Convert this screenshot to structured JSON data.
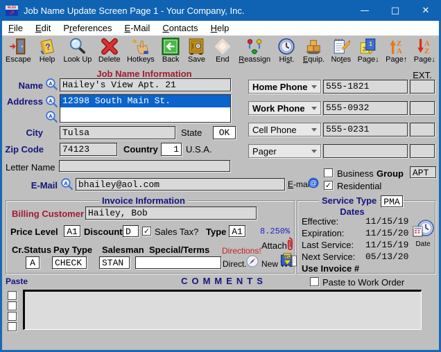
{
  "window": {
    "title": "Job Name Update Screen Page 1 - Your Company, Inc.",
    "icon_text": "BLSS",
    "controls": {
      "minimize": "—",
      "maximize": "□",
      "close": "✕"
    }
  },
  "menu": [
    {
      "pre": "",
      "key": "F",
      "post": "ile"
    },
    {
      "pre": "",
      "key": "E",
      "post": "dit"
    },
    {
      "pre": "P",
      "key": "r",
      "post": "eferences"
    },
    {
      "pre": "",
      "key": "E",
      "post": "-Mail"
    },
    {
      "pre": "",
      "key": "C",
      "post": "ontacts"
    },
    {
      "pre": "",
      "key": "H",
      "post": "elp"
    }
  ],
  "toolbar": [
    {
      "pre": "Escape",
      "key": "",
      "post": ""
    },
    {
      "pre": "Help",
      "key": "",
      "post": ""
    },
    {
      "pre": "Look Up",
      "key": "",
      "post": ""
    },
    {
      "pre": "Delete",
      "key": "",
      "post": ""
    },
    {
      "pre": "Hotkeys",
      "key": "",
      "post": ""
    },
    {
      "pre": "Back",
      "key": "",
      "post": ""
    },
    {
      "pre": "Save",
      "key": "",
      "post": ""
    },
    {
      "pre": "End",
      "key": "",
      "post": ""
    },
    {
      "pre": "",
      "key": "R",
      "post": "eassign"
    },
    {
      "pre": "Hi",
      "key": "s",
      "post": "t."
    },
    {
      "pre": "",
      "key": "E",
      "post": "quip."
    },
    {
      "pre": "No",
      "key": "t",
      "post": "es"
    },
    {
      "pre": "Page↓",
      "key": "",
      "post": ""
    },
    {
      "pre": "Page↑",
      "key": "",
      "post": ""
    },
    {
      "pre": "Page↓",
      "key": "",
      "post": ""
    }
  ],
  "job": {
    "section_title": "Job Name Information",
    "name_label": "Name",
    "name_value": "Hailey's View Apt. 21",
    "address_label": "Address",
    "address_line1": "12398 South Main St.",
    "city_label": "City",
    "city_value": "Tulsa",
    "state_label": "State",
    "state_value": "OK",
    "zip_label": "Zip Code",
    "zip_value": "74123",
    "country_label": "Country",
    "country_value": "1",
    "country_name": "U.S.A.",
    "letter_label": "Letter Name",
    "letter_value": "",
    "email_label": "E-Mail",
    "email_value": "bhailey@aol.com",
    "emails": {
      "pre": "",
      "key": "E",
      "post": "-mails"
    },
    "ext_label": "EXT.",
    "phones": [
      {
        "type": "Home Phone",
        "number": "555-1821",
        "ext": ""
      },
      {
        "type": "Work Phone",
        "number": "555-0932",
        "ext": ""
      },
      {
        "type": "Cell Phone",
        "number": "555-0231",
        "ext": ""
      },
      {
        "type": "Pager",
        "number": "",
        "ext": ""
      }
    ],
    "business_label": "Business",
    "group_label": "Group",
    "group_value": "APT",
    "residential_label": "Residential"
  },
  "checks": {
    "business": "",
    "residential": "✓",
    "sales_tax": "✓",
    "paste_wo": "",
    "paste_rows": [
      "",
      "",
      "",
      ""
    ]
  },
  "invoice": {
    "section_title": "Invoice Information",
    "billing_label": "Billing Customer",
    "billing_value": "Hailey, Bob",
    "price_level_label": "Price Level",
    "price_level_value": "A1",
    "discount_label": "Discount",
    "discount_value": "D",
    "sales_tax_label": "Sales Tax?",
    "type_label": "Type",
    "type_value": "A1",
    "tax_rate": "8.250%",
    "cr_status_label": "Cr.Status",
    "pay_type_label": "Pay Type",
    "salesman_label": "Salesman",
    "special_label": "Special/Terms",
    "directions_label": "Directions!",
    "attach_label": "Attach",
    "cr_status_value": "A",
    "pay_type_value": "CHECK",
    "salesman_value": "STAN",
    "special_value": "",
    "direct_label": "Direct.",
    "new_wo_label": "New WO"
  },
  "service": {
    "section_title": "Service Type",
    "type_value": "PMA",
    "dates_label": "Dates",
    "rows": [
      {
        "label": "Effective:",
        "value": "11/15/19"
      },
      {
        "label": "Expiration:",
        "value": "11/15/20"
      },
      {
        "label": "Last Service:",
        "value": "11/15/19"
      },
      {
        "label": "Next Service:",
        "value": "05/13/20"
      }
    ],
    "use_invoice_label": "Use Invoice #",
    "date_icon_label": "Date"
  },
  "comments": {
    "paste_label": "Paste",
    "title": "COMMENTS",
    "paste_to_wo_label": "Paste to Work Order",
    "value": ""
  },
  "colors": {
    "titlebar": "#0f63b2",
    "window_border": "#1769b6",
    "menubar_bg": "#ffffff",
    "surface": "#bfbfbf",
    "field_bg": "#d9d9d9",
    "highlight": "#0a64cc",
    "navy": "#14147e",
    "maroon": "#9e1c33",
    "red": "#c42222",
    "blue_text": "#2121c8"
  }
}
